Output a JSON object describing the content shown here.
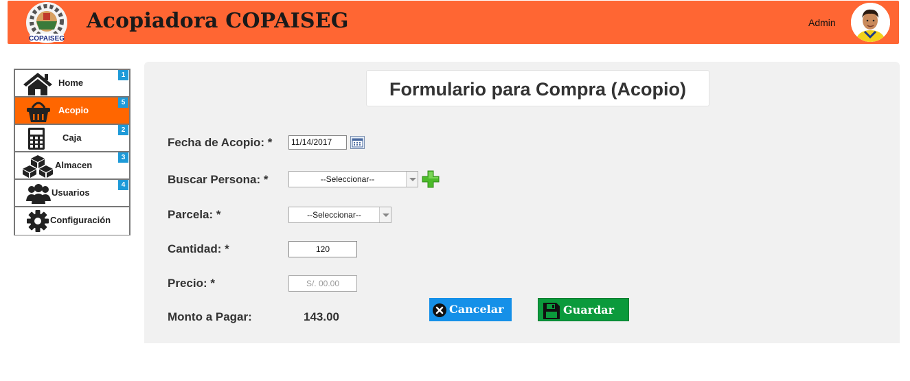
{
  "header": {
    "app_title": "Acopiadora COPAISEG",
    "logo_text": "COPAISEG",
    "user_label": "Admin",
    "accent_color": "#ff6633"
  },
  "sidebar": {
    "items": [
      {
        "label": "Home",
        "badge": "1",
        "icon": "home-icon",
        "active": false
      },
      {
        "label": "Acopio",
        "badge": "5",
        "icon": "basket-icon",
        "active": true
      },
      {
        "label": "Caja",
        "badge": "2",
        "icon": "calculator-icon",
        "active": false
      },
      {
        "label": "Almacen",
        "badge": "3",
        "icon": "boxes-icon",
        "active": false
      },
      {
        "label": "Usuarios",
        "badge": "4",
        "icon": "users-icon",
        "active": false
      },
      {
        "label": "Configuración",
        "badge": "",
        "icon": "gear-icon",
        "active": false
      }
    ]
  },
  "form": {
    "title": "Formulario para Compra (Acopio)",
    "fecha_label": "Fecha de Acopio: *",
    "fecha_value": "11/14/2017",
    "persona_label": "Buscar Persona: *",
    "persona_value": "--Seleccionar--",
    "parcela_label": "Parcela: *",
    "parcela_value": "--Seleccionar--",
    "cantidad_label": "Cantidad: *",
    "cantidad_value": "120",
    "precio_label": "Precio: *",
    "precio_placeholder": "S/. 00.00",
    "monto_label": "Monto a Pagar:",
    "monto_value": "143.00",
    "cancel_label": "Cancelar",
    "save_label": "Guardar"
  }
}
